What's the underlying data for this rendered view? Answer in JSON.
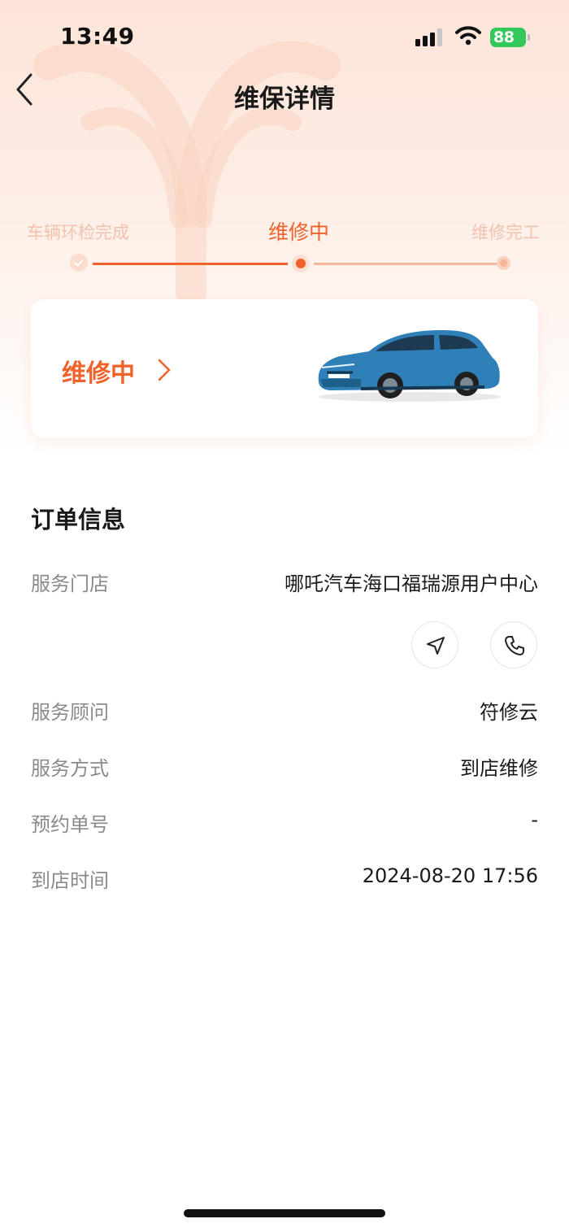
{
  "status_bar": {
    "time": "13:49",
    "battery": "88"
  },
  "nav": {
    "title": "维保详情"
  },
  "progress": {
    "steps": [
      {
        "label": "车辆环检完成",
        "state": "done"
      },
      {
        "label": "维修中",
        "state": "current"
      },
      {
        "label": "维修完工",
        "state": "pending"
      }
    ]
  },
  "status_card": {
    "status": "维修中"
  },
  "order": {
    "title": "订单信息",
    "store_label": "服务门店",
    "store_value": "哪吒汽车海口福瑞源用户中心",
    "advisor_label": "服务顾问",
    "advisor_value": "符修云",
    "method_label": "服务方式",
    "method_value": "到店维修",
    "booking_label": "预约单号",
    "booking_value": "-",
    "arrival_label": "到店时间",
    "arrival_value": "2024-08-20 17:56"
  },
  "colors": {
    "accent": "#f0622a",
    "battery": "#34c759",
    "car_body": "#2f7fb8"
  },
  "icons": [
    "back-chevron-icon",
    "check-icon",
    "chevron-right-icon",
    "navigation-arrow-icon",
    "phone-icon"
  ]
}
